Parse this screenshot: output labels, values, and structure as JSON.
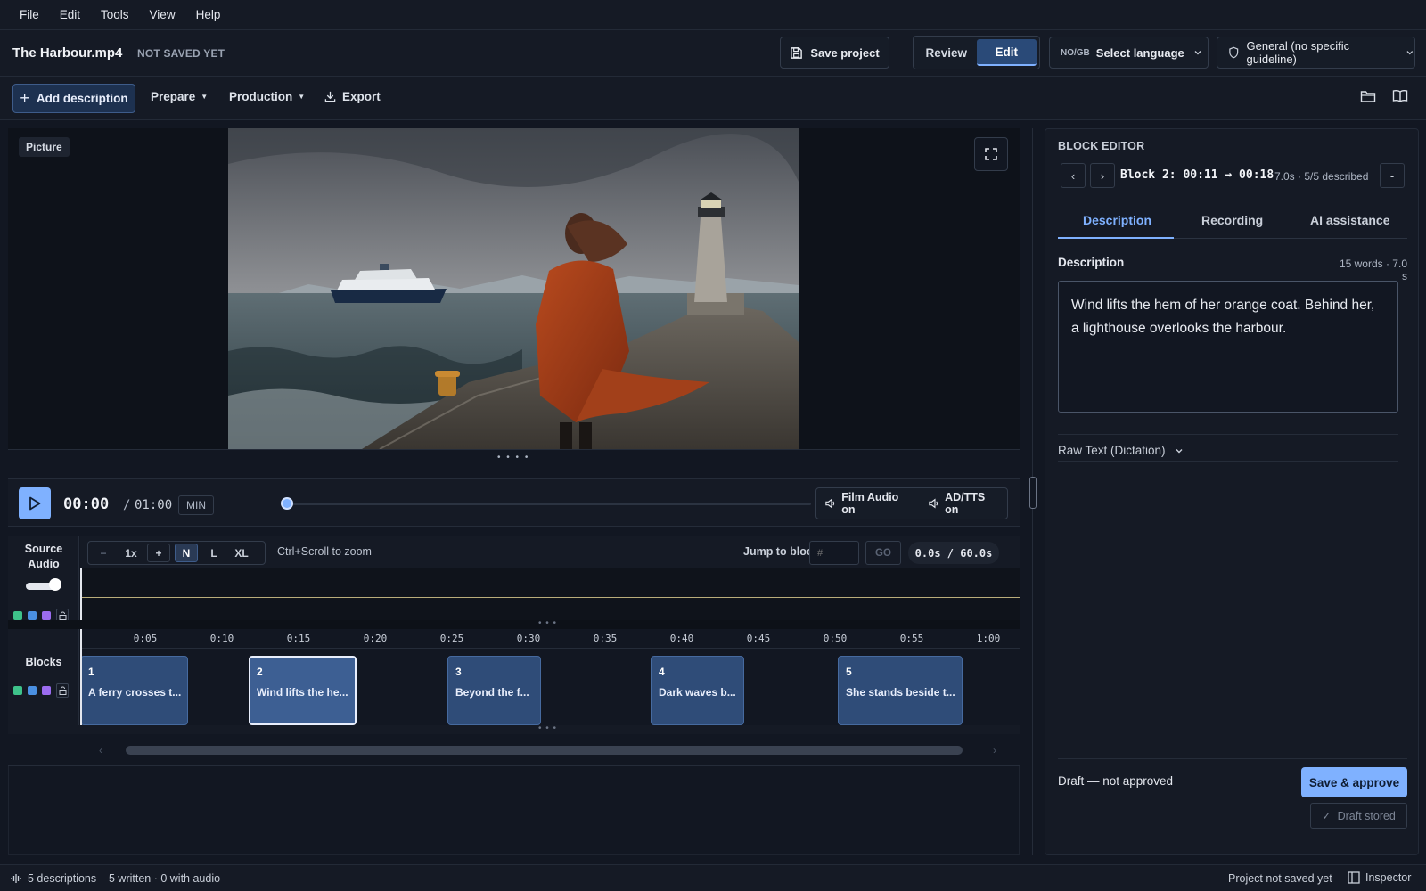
{
  "menu": [
    "File",
    "Edit",
    "Tools",
    "View",
    "Help"
  ],
  "header": {
    "file_name": "The Harbour.mp4",
    "save_state": "NOT SAVED YET",
    "save_project": "Save project",
    "modes": [
      "Review",
      "Edit"
    ],
    "active_mode": "Edit",
    "lang_code": "NO/GB",
    "lang_label": "Select language",
    "guideline": "General (no specific guideline)"
  },
  "toolbar": {
    "add_description": "Add description",
    "prepare": "Prepare",
    "production": "Production",
    "export": "Export"
  },
  "picture": {
    "label": "Picture",
    "scene": "Woman in an orange coat on a harbour pier with a lighthouse and a ferry"
  },
  "transport": {
    "current_time": "00:00",
    "separator": "/",
    "total_time": "01:00",
    "mode_badge": "MIN",
    "progress": 0.0,
    "film_audio": "Film Audio on",
    "ad_tts": "AD/TTS on"
  },
  "source_audio": {
    "label_line1": "Source",
    "label_line2": "Audio"
  },
  "zoom": {
    "minus": "−",
    "speed": "1x",
    "plus": "+",
    "sizes": [
      "N",
      "L",
      "XL"
    ],
    "active_size": "N",
    "hint": "Ctrl+Scroll to zoom",
    "jump_label": "Jump to block",
    "jump_placeholder": "#",
    "go": "GO",
    "range": "0.0s / 60.0s"
  },
  "timeline": {
    "label": "Blocks",
    "ticks": [
      "0:05",
      "0:10",
      "0:15",
      "0:20",
      "0:25",
      "0:30",
      "0:35",
      "0:40",
      "0:45",
      "0:50",
      "0:55",
      "1:00"
    ],
    "blocks": [
      {
        "num": "1",
        "text": "A ferry crosses t..."
      },
      {
        "num": "2",
        "text": "Wind lifts the he..."
      },
      {
        "num": "3",
        "text": "Beyond the f..."
      },
      {
        "num": "4",
        "text": "Dark waves b..."
      },
      {
        "num": "5",
        "text": "She stands beside t..."
      }
    ]
  },
  "editor": {
    "title": "BLOCK EDITOR",
    "block_heading": "Block 2: 00:11 → 00:18",
    "block_meta": "7.0s · 5/5 described",
    "collapse": "-",
    "tabs": [
      "Description",
      "Recording",
      "AI assistance"
    ],
    "active_tab": "Description",
    "desc_label": "Description",
    "desc_stats": "15 words · 7.0 s",
    "description": "Wind lifts the hem of her orange coat. Behind her, a lighthouse overlooks the harbour.",
    "raw_text": "Raw Text (Dictation)",
    "draft_status": "Draft — not approved",
    "approve": "Save & approve",
    "draft_stored": "Draft stored"
  },
  "status": {
    "descriptions": "5 descriptions",
    "written": "5 written · 0 with audio",
    "project": "Project not saved yet",
    "inspector": "Inspector"
  },
  "colors": {
    "accent": "#7fb1ff",
    "block": "#2f4c78",
    "background": "#121722"
  }
}
